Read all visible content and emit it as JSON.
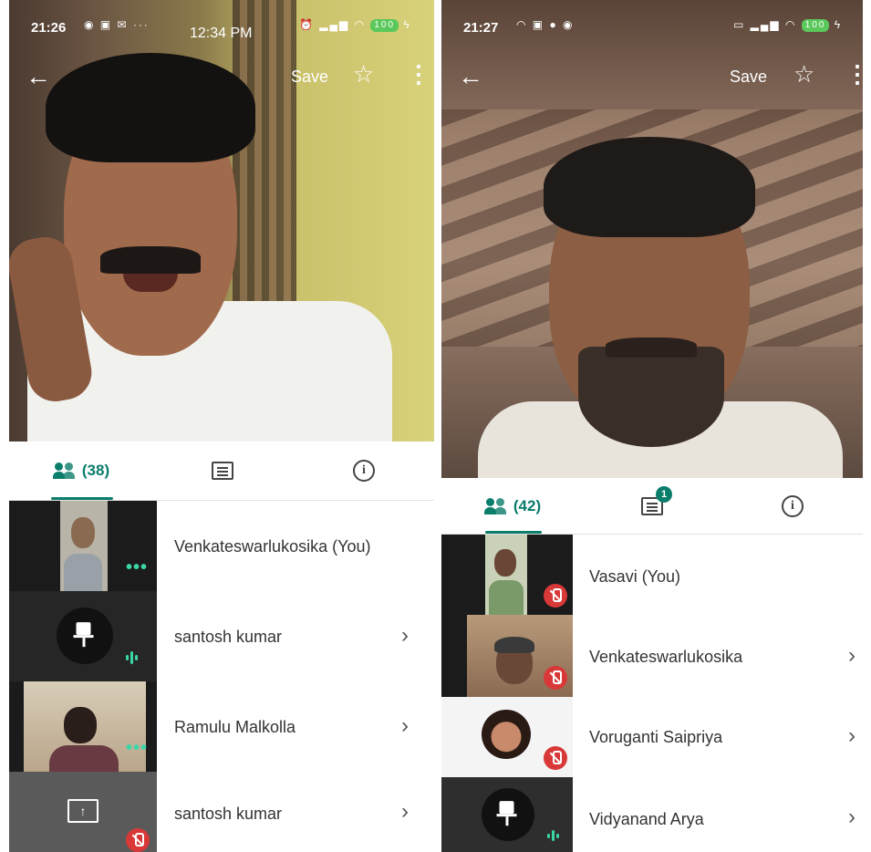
{
  "left": {
    "status": {
      "time": "21:26",
      "clock": "12:34 PM",
      "battery": "100"
    },
    "topbar": {
      "save_label": "Save"
    },
    "tabs": {
      "people_count": "(38)"
    },
    "participants": [
      {
        "name": "Venkateswarlukosika (You)",
        "status": "speaking-dots"
      },
      {
        "name": "santosh kumar",
        "status": "audio-level"
      },
      {
        "name": "Ramulu Malkolla",
        "status": "speaking-dots"
      },
      {
        "name": "santosh kumar",
        "status": "muted"
      }
    ]
  },
  "right": {
    "status": {
      "time": "21:27",
      "battery": "100"
    },
    "topbar": {
      "save_label": "Save"
    },
    "tabs": {
      "people_count": "(42)",
      "chat_badge": "1"
    },
    "participants": [
      {
        "name": "Vasavi (You)",
        "status": "muted"
      },
      {
        "name": "Venkateswarlukosika",
        "status": "muted"
      },
      {
        "name": "Voruganti Saipriya",
        "status": "muted"
      },
      {
        "name": "Vidyanand Arya",
        "status": "audio-level"
      }
    ]
  },
  "colors": {
    "accent": "#0b7d6b",
    "speaking": "#3ad6a6",
    "muted": "#d93838"
  },
  "icons": [
    "back-arrow-icon",
    "star-icon",
    "more-vert-icon",
    "people-icon",
    "chat-icon",
    "info-icon",
    "chevron-right-icon",
    "mic-off-icon",
    "pin-icon",
    "present-icon",
    "speaker-off-icon"
  ]
}
